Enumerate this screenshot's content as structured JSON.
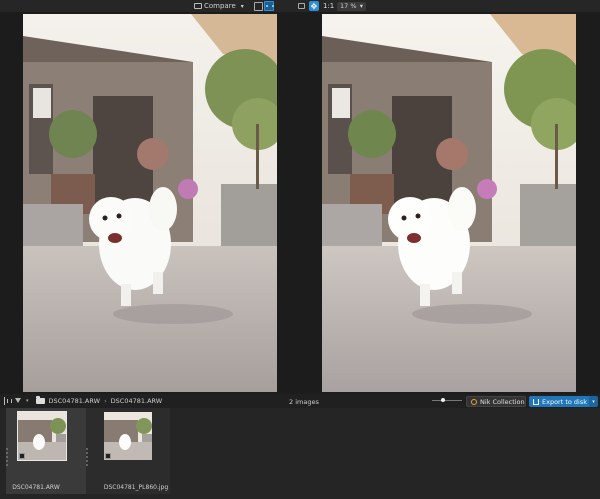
{
  "toolbar": {
    "compare_label": "Compare",
    "zoom_fit_label": "1:1",
    "zoom_value": "17 %",
    "compare_icon": "compare-icon",
    "layout_single_icon": "single-view-icon",
    "layout_split_icon": "split-view-icon",
    "crop_icon": "crop-icon",
    "hand_icon": "hand-tool-icon"
  },
  "viewer": {
    "left_image_file": "DSC04781.ARW",
    "right_image_file": "DSC04781_PL860.jpg",
    "divider_dots": "···"
  },
  "statusbar": {
    "breadcrumb": [
      "DSC04781.ARW",
      "DSC04781.ARW"
    ],
    "breadcrumb_sep": "›",
    "image_count": "2 images",
    "nik_label": "Nik Collection",
    "export_label": "Export to disk",
    "slider_level": 0.37
  },
  "filmstrip": {
    "items": [
      {
        "label": "DSC04781.ARW",
        "selected": true
      },
      {
        "label": "DSC04781_PL860.jpg",
        "selected": false
      }
    ]
  },
  "colors": {
    "accent": "#2d8fd6",
    "export_button": "#1f76b8",
    "background": "#1c1c1c"
  }
}
